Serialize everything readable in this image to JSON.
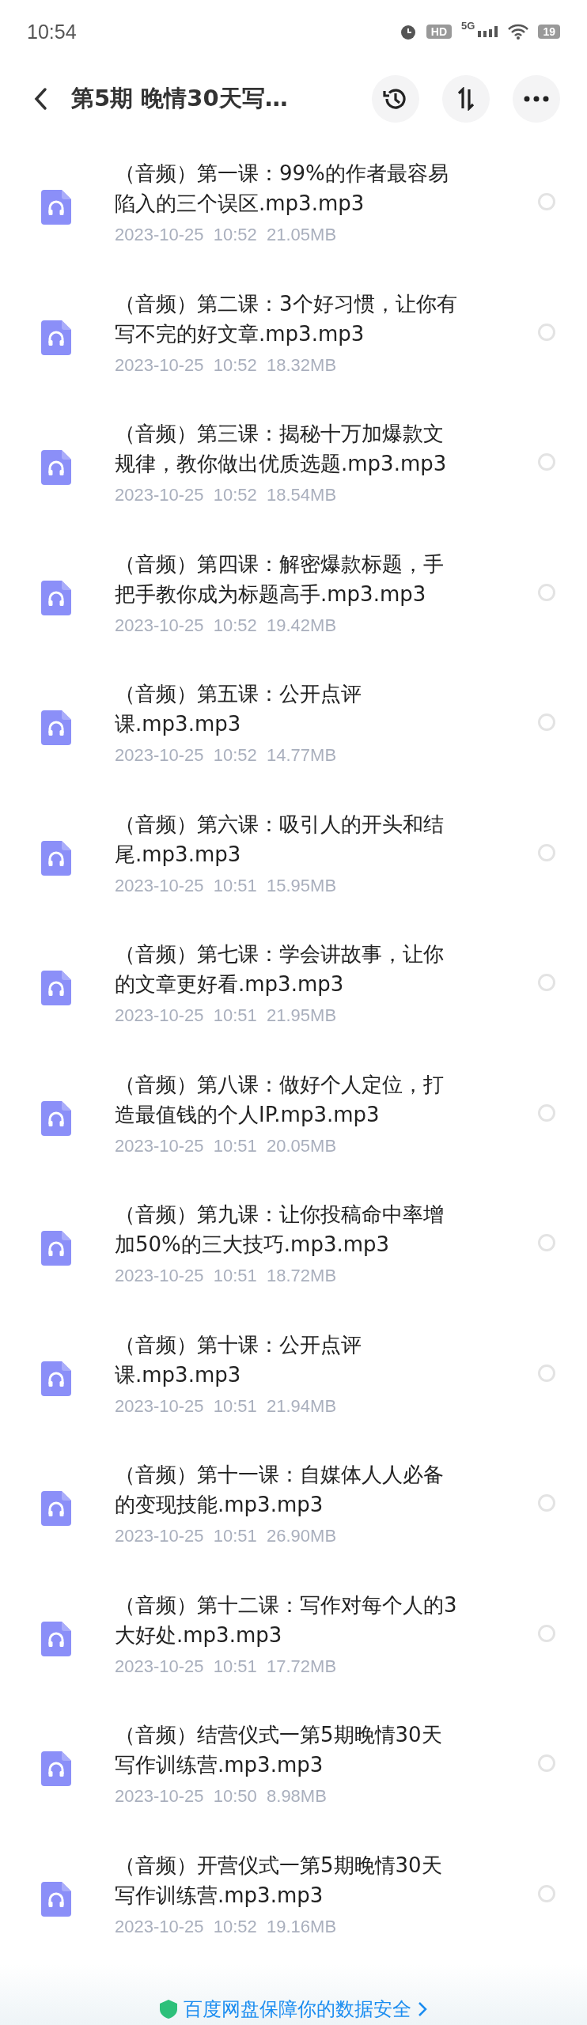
{
  "status_bar": {
    "time": "10:54",
    "hd": "HD",
    "network": "5G",
    "battery": "19"
  },
  "header": {
    "title": "第5期 晚情30天写…"
  },
  "files": [
    {
      "title_lines": [
        "（音频）第一课：99%的作者最容易",
        "陷入的三个误区.mp3.mp3"
      ],
      "meta": "2023-10-25  10:52  21.05MB",
      "selected": false
    },
    {
      "title_lines": [
        "（音频）第二课：3个好习惯，让你有",
        "写不完的好文章.mp3.mp3"
      ],
      "meta": "2023-10-25  10:52  18.32MB",
      "selected": false
    },
    {
      "title_lines": [
        "（音频）第三课：揭秘十万加爆款文",
        "规律，教你做出优质选题.mp3.mp3"
      ],
      "meta": "2023-10-25  10:52  18.54MB",
      "selected": false
    },
    {
      "title_lines": [
        "（音频）第四课：解密爆款标题，手",
        "把手教你成为标题高手.mp3.mp3"
      ],
      "meta": "2023-10-25  10:52  19.42MB",
      "selected": false
    },
    {
      "title_lines": [
        "（音频）第五课：公开点评",
        "课.mp3.mp3"
      ],
      "meta": "2023-10-25  10:52  14.77MB",
      "selected": false
    },
    {
      "title_lines": [
        "（音频）第六课：吸引人的开头和结",
        "尾.mp3.mp3"
      ],
      "meta": "2023-10-25  10:51  15.95MB",
      "selected": false
    },
    {
      "title_lines": [
        "（音频）第七课：学会讲故事，让你",
        "的文章更好看.mp3.mp3"
      ],
      "meta": "2023-10-25  10:51  21.95MB",
      "selected": false
    },
    {
      "title_lines": [
        "（音频）第八课：做好个人定位，打",
        "造最值钱的个人IP.mp3.mp3"
      ],
      "meta": "2023-10-25  10:51  20.05MB",
      "selected": false
    },
    {
      "title_lines": [
        "（音频）第九课：让你投稿命中率增",
        "加50%的三大技巧.mp3.mp3"
      ],
      "meta": "2023-10-25  10:51  18.72MB",
      "selected": false
    },
    {
      "title_lines": [
        "（音频）第十课：公开点评",
        "课.mp3.mp3"
      ],
      "meta": "2023-10-25  10:51  21.94MB",
      "selected": false
    },
    {
      "title_lines": [
        "（音频）第十一课：自媒体人人必备",
        "的变现技能.mp3.mp3"
      ],
      "meta": "2023-10-25  10:51  26.90MB",
      "selected": false
    },
    {
      "title_lines": [
        "（音频）第十二课：写作对每个人的3",
        "大好处.mp3.mp3"
      ],
      "meta": "2023-10-25  10:51  17.72MB",
      "selected": false
    },
    {
      "title_lines": [
        "（音频）结营仪式一第5期晚情30天",
        "写作训练营.mp3.mp3"
      ],
      "meta": "2023-10-25  10:50  8.98MB",
      "selected": false
    },
    {
      "title_lines": [
        "（音频）开营仪式一第5期晚情30天",
        "写作训练营.mp3.mp3"
      ],
      "meta": "2023-10-25  10:52  19.16MB",
      "selected": false
    }
  ],
  "footer": {
    "text": "百度网盘保障你的数据安全"
  }
}
